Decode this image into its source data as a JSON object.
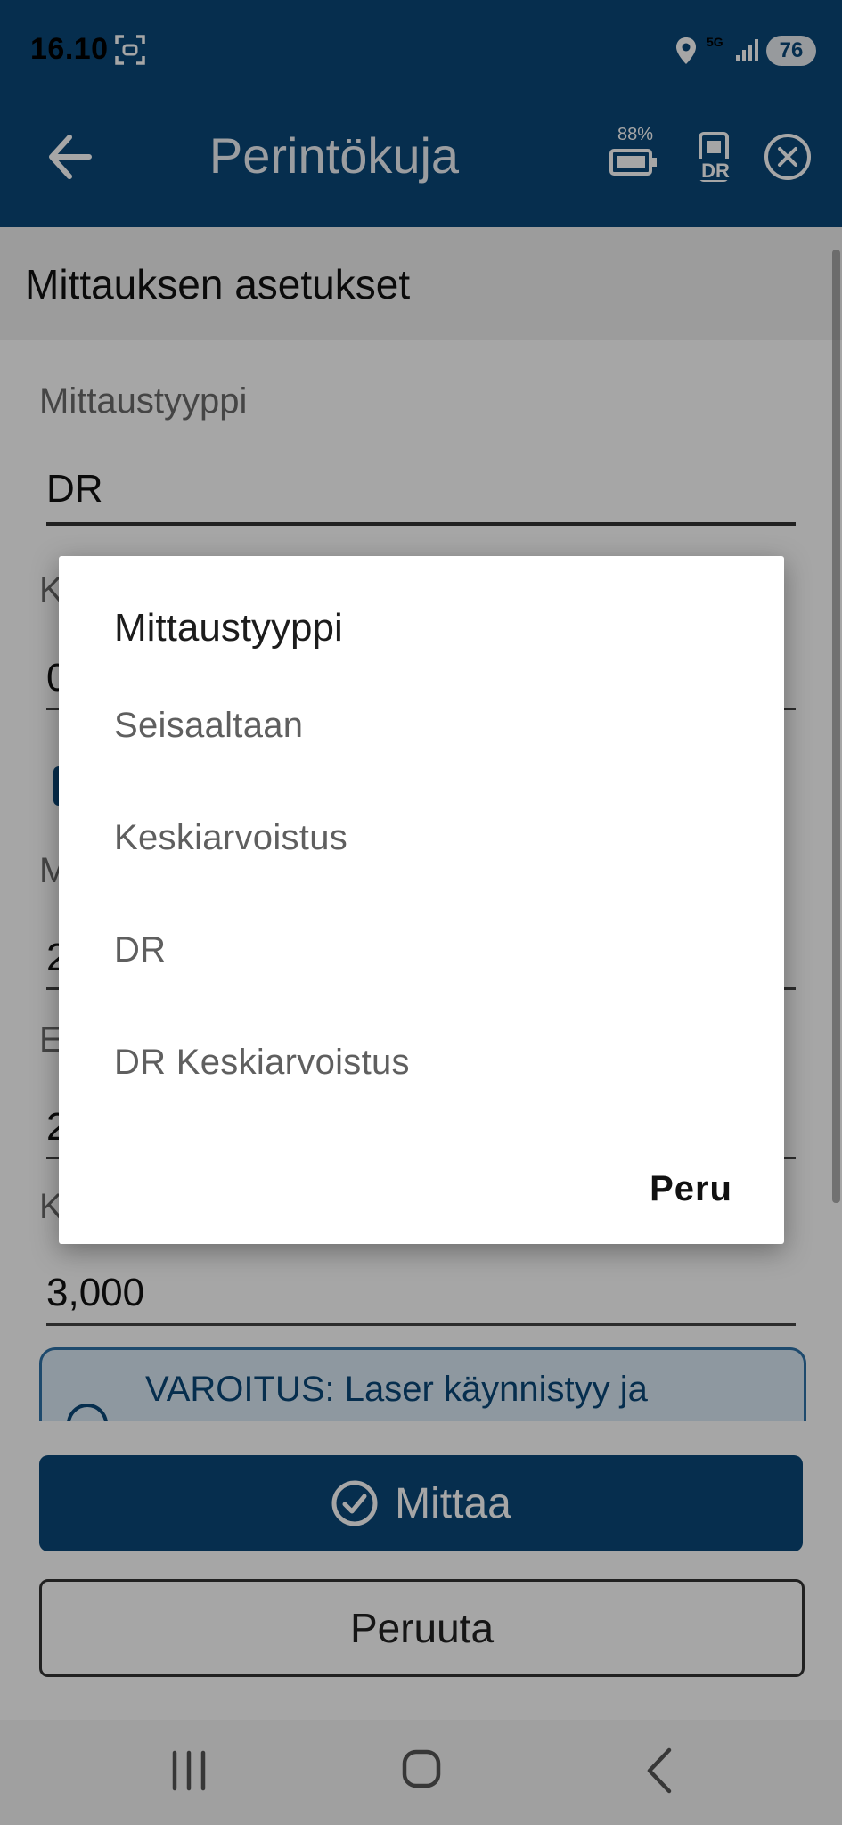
{
  "status_bar": {
    "time": "16.10",
    "network": "5G",
    "battery_level": "76",
    "icons": [
      "screenshot-icon",
      "location-icon",
      "signal-icon"
    ]
  },
  "app_bar": {
    "title": "Perintökuja",
    "device_battery": "88%",
    "icons": [
      "back-arrow-icon",
      "battery-icon",
      "dr-device-icon",
      "close-icon"
    ]
  },
  "section": {
    "title": "Mittauksen asetukset"
  },
  "form": {
    "measurement_type_label": "Mittaustyyppi",
    "measurement_type_value": "DR",
    "field2_label_partial": "K",
    "field2_value_partial": "0",
    "field3_label_partial": "M",
    "field3_value_partial": "2",
    "field4_label_partial": "E",
    "field4_value_partial": "2",
    "field5_label_partial": "K",
    "field5_value": "3,000"
  },
  "warning": {
    "text": "VAROITUS: Laser käynnistyy ja"
  },
  "buttons": {
    "measure": "Mittaa",
    "cancel": "Peruuta"
  },
  "dialog": {
    "title": "Mittaustyyppi",
    "options": [
      "Seisaaltaan",
      "Keskiarvoistus",
      "DR",
      "DR Keskiarvoistus"
    ],
    "cancel": "Peru"
  },
  "nav_bar": {
    "icons": [
      "recent-apps-icon",
      "home-icon",
      "back-icon"
    ]
  },
  "colors": {
    "primary": "#0a4778",
    "scrim": "rgba(0,0,0,0.35)"
  }
}
